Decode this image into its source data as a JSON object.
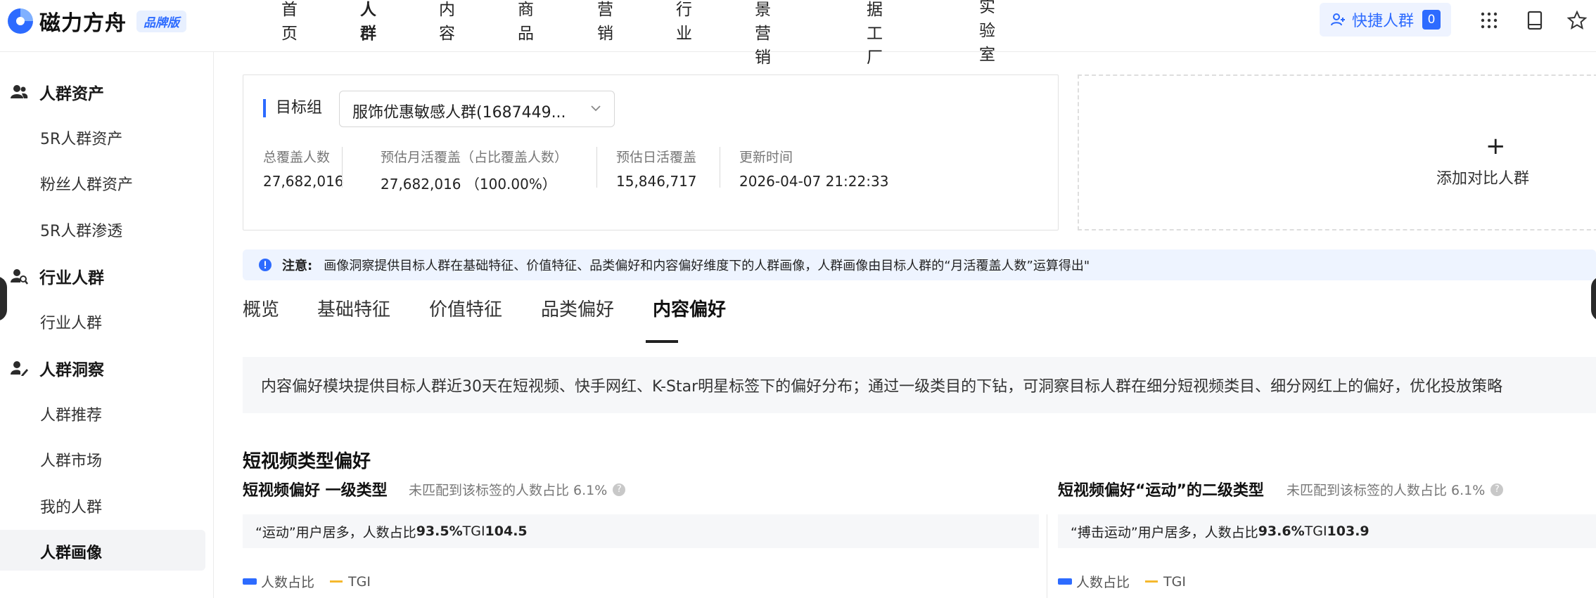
{
  "header": {
    "logo_text": "磁力方舟",
    "brand_badge": "品牌版",
    "nav": [
      "首页",
      "人群",
      "内容",
      "商品",
      "营销",
      "行业",
      "场景营销",
      "数据工厂",
      "AI实验室"
    ],
    "nav_active_index": 1,
    "quick_label": "快捷人群",
    "quick_count": "0"
  },
  "sidebar": {
    "groups": [
      {
        "label": "人群资产",
        "icon": "people-icon",
        "items": [
          "5R人群资产",
          "粉丝人群资产",
          "5R人群渗透"
        ]
      },
      {
        "label": "行业人群",
        "icon": "people-search-icon",
        "items": [
          "行业人群"
        ]
      },
      {
        "label": "人群洞察",
        "icon": "people-insight-icon",
        "items": [
          "人群推荐",
          "人群市场",
          "我的人群",
          "人群画像"
        ]
      }
    ],
    "active_item": "人群画像"
  },
  "target": {
    "label": "目标组",
    "selected": "服饰优惠敏感人群(1687449...",
    "stats": [
      {
        "key": "总覆盖人数",
        "value": "27,682,016"
      },
      {
        "key": "预估月活覆盖（占比覆盖人数）",
        "value": "27,682,016 （100.00%）"
      },
      {
        "key": "预估日活覆盖",
        "value": "15,846,717"
      },
      {
        "key": "更新时间",
        "value": "2026-04-07 21:22:33"
      }
    ],
    "add_compare": "添加对比人群",
    "add_plus": "+"
  },
  "notice": {
    "title": "注意:",
    "text": "画像洞察提供目标人群在基础特征、价值特征、品类偏好和内容偏好维度下的人群画像，人群画像由目标人群的“月活覆盖人数”运算得出\""
  },
  "tabs": [
    "概览",
    "基础特征",
    "价值特征",
    "品类偏好",
    "内容偏好"
  ],
  "tab_active_index": 4,
  "description": "内容偏好模块提供目标人群近30天在短视频、快手网红、K-Star明星标签下的偏好分布；通过一级类目的下钻，可洞察目标人群在细分短视频类目、细分网红上的偏好，优化投放策略",
  "section_title": "短视频类型偏好",
  "left_panel": {
    "title": "短视频偏好 一级类型",
    "note": "未匹配到该标签的人数占比 6.1%",
    "insight_prefix": "“运动”用户居多，人数占比",
    "insight_pct": "93.5%",
    "insight_tgi_label": " TGI",
    "insight_tgi": "104.5",
    "legend": [
      "人数占比",
      "TGI"
    ]
  },
  "right_panel": {
    "title": "短视频偏好“运动”的二级类型",
    "note": "未匹配到该标签的人数占比 6.1%",
    "insight_prefix": "“搏击运动”用户居多，人数占比",
    "insight_pct": "93.6%",
    "insight_tgi_label": " TGI",
    "insight_tgi": "103.9",
    "legend": [
      "人数占比",
      "TGI"
    ]
  },
  "colors": {
    "accent": "#2d6bff",
    "tgi": "#f5b82e",
    "notice_bg": "#eef4ff"
  }
}
